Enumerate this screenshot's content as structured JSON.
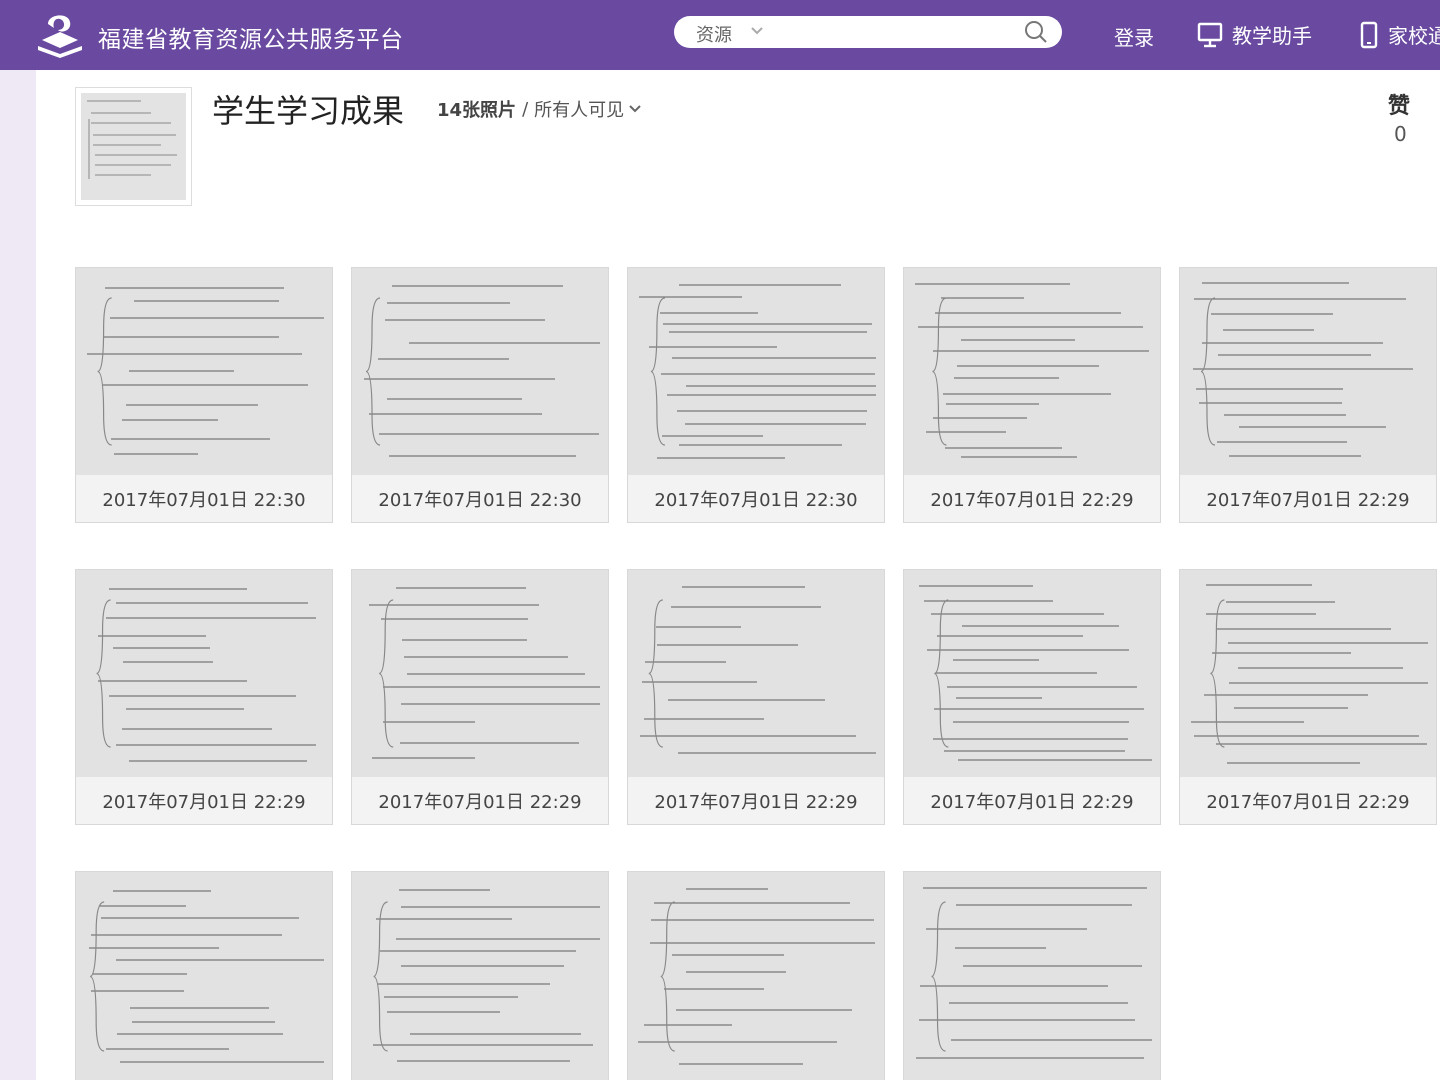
{
  "header": {
    "site_title": "福建省教育资源公共服务平台",
    "search_scope": "资源",
    "search_placeholder": "",
    "login": "登录",
    "teaching_assistant": "教学助手",
    "home_school": "家校通",
    "logo_icon": "education-logo-icon",
    "accent_color": "#6a4aa0"
  },
  "album": {
    "title": "学生学习成果",
    "photo_count": "14张照片",
    "separator": "/",
    "visibility": "所有人可见",
    "like_label": "赞",
    "like_count": "0"
  },
  "photos": [
    {
      "time": "2017年07月01日 22:30"
    },
    {
      "time": "2017年07月01日 22:30"
    },
    {
      "time": "2017年07月01日 22:30"
    },
    {
      "time": "2017年07月01日 22:29"
    },
    {
      "time": "2017年07月01日 22:29"
    },
    {
      "time": "2017年07月01日 22:29"
    },
    {
      "time": "2017年07月01日 22:29"
    },
    {
      "time": "2017年07月01日 22:29"
    },
    {
      "time": "2017年07月01日 22:29"
    },
    {
      "time": "2017年07月01日 22:29"
    }
  ]
}
